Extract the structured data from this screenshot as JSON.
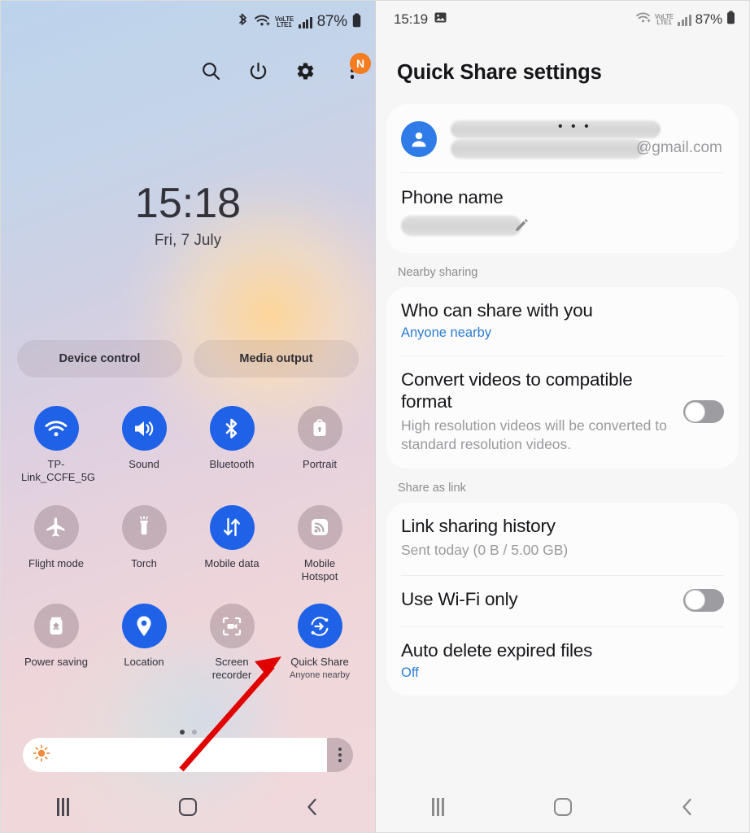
{
  "left_panel": {
    "status_bar": {
      "bluetooth_icon": "bluetooth-icon",
      "wifi_icon": "wifi-icon",
      "volte_top": "VoLTE",
      "volte_bottom": "LTE1",
      "signal_icon": "signal-bars-icon",
      "battery_percent": "87%",
      "battery_icon": "battery-icon"
    },
    "actions": [
      {
        "name": "search-icon",
        "label": "Search"
      },
      {
        "name": "power-icon",
        "label": "Power"
      },
      {
        "name": "settings-gear-icon",
        "label": "Settings"
      },
      {
        "name": "more-options-icon",
        "label": "More options",
        "badge": "N"
      }
    ],
    "clock": {
      "time": "15:18",
      "date": "Fri, 7 July"
    },
    "pills": [
      {
        "label": "Device control"
      },
      {
        "label": "Media output"
      }
    ],
    "tiles": [
      {
        "label": "TP-Link_CCFE_5G",
        "sub": "",
        "state": "on",
        "icon": "wifi-icon"
      },
      {
        "label": "Sound",
        "sub": "",
        "state": "on",
        "icon": "sound-icon"
      },
      {
        "label": "Bluetooth",
        "sub": "",
        "state": "on",
        "icon": "bluetooth-icon"
      },
      {
        "label": "Portrait",
        "sub": "",
        "state": "off",
        "icon": "rotation-lock-icon"
      },
      {
        "label": "Flight mode",
        "sub": "",
        "state": "off",
        "icon": "airplane-icon"
      },
      {
        "label": "Torch",
        "sub": "",
        "state": "off",
        "icon": "flashlight-icon"
      },
      {
        "label": "Mobile data",
        "sub": "",
        "state": "on",
        "icon": "mobile-data-icon"
      },
      {
        "label": "Mobile Hotspot",
        "sub": "",
        "state": "off",
        "icon": "hotspot-icon"
      },
      {
        "label": "Power saving",
        "sub": "",
        "state": "off",
        "icon": "power-saving-icon"
      },
      {
        "label": "Location",
        "sub": "",
        "state": "on",
        "icon": "location-pin-icon"
      },
      {
        "label": "Screen recorder",
        "sub": "",
        "state": "off",
        "icon": "screen-recorder-icon"
      },
      {
        "label": "Quick Share",
        "sub": "Anyone nearby",
        "state": "on",
        "icon": "quick-share-icon"
      }
    ],
    "page_dots": {
      "total": 2,
      "active_index": 0
    },
    "brightness": {
      "icon": "brightness-sun-icon",
      "level_percent": 95,
      "more_icon": "more-options-icon"
    },
    "nav": {
      "recents": "Recents",
      "home": "Home",
      "back": "Back"
    },
    "annotation": {
      "type": "arrow",
      "color": "#e00000",
      "points_to": "Quick Share"
    }
  },
  "right_panel": {
    "status_bar": {
      "time": "15:19",
      "image_icon": "image-notification-icon",
      "wifi_icon": "wifi-icon",
      "volte_top": "VoLTE",
      "volte_bottom": "LTE1",
      "signal_icon": "signal-bars-icon",
      "battery_percent": "87%",
      "battery_icon": "battery-icon"
    },
    "title": "Quick Share settings",
    "account": {
      "avatar_icon": "person-avatar-icon",
      "name_redacted": "• • •",
      "email_suffix": "@gmail.com"
    },
    "phone_name": {
      "label": "Phone name",
      "edit_icon": "pencil-edit-icon"
    },
    "groups": [
      {
        "header": "Nearby sharing",
        "items": [
          {
            "title": "Who can share with you",
            "sub_blue": "Anyone nearby",
            "control": "none"
          },
          {
            "title": "Convert videos to compatible format",
            "sub_gray": "High resolution videos will be converted to standard resolution videos.",
            "control": "toggle",
            "toggle_on": false
          }
        ]
      },
      {
        "header": "Share as link",
        "items": [
          {
            "title": "Link sharing history",
            "sub_gray": "Sent today (0 B / 5.00 GB)",
            "control": "none"
          },
          {
            "title": "Use Wi-Fi only",
            "control": "toggle",
            "toggle_on": false
          },
          {
            "title": "Auto delete expired files",
            "sub_blue": "Off",
            "control": "none"
          }
        ]
      }
    ],
    "nav": {
      "recents": "Recents",
      "home": "Home",
      "back": "Back"
    }
  },
  "colors": {
    "accent_blue": "#1f62e8",
    "link_blue": "#2b7cd3",
    "badge_orange": "#f57c20",
    "annotation_red": "#e00000",
    "toggle_off": "#9d9da1"
  }
}
